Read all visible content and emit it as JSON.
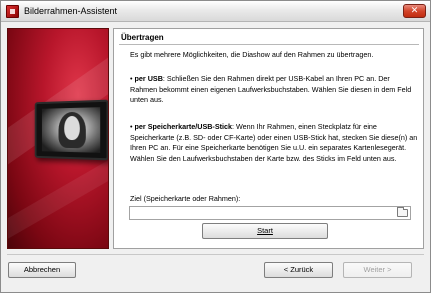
{
  "window": {
    "title": "Bilderrahmen-Assistent",
    "close_glyph": "✕"
  },
  "banner": {
    "image": "digital-photo-frame-icon"
  },
  "panel": {
    "heading": "Übertragen",
    "intro": "Es gibt mehrere Möglichkeiten, die Diashow auf den Rahmen zu übertragen.",
    "usb_bullet": "•",
    "usb_title": "per USB",
    "usb_text": ": Schließen Sie den Rahmen direkt per USB-Kabel an Ihren PC an. Der Rahmen bekommt einen eigenen Laufwerksbuchstaben. Wählen Sie diesen in dem Feld unten aus.",
    "card_bullet": "•",
    "card_title": "per Speicherkarte/USB-Stick",
    "card_text": ": Wenn Ihr Rahmen, einen Steckplatz für eine Speicherkarte (z.B. SD- oder CF-Karte) oder einen USB-Stick hat, stecken Sie diese(n)  an Ihren PC an. Für eine Speicherkarte benötigen Sie u.U. ein separates Kartenlesegerät. Wählen Sie den Laufwerksbuchstaben der Karte bzw. des Sticks im Feld unten aus.",
    "target_label": "Ziel (Speicherkarte oder Rahmen):",
    "target_value": "",
    "start_label": "Start"
  },
  "footer": {
    "cancel_label": "Abbrechen",
    "back_label": "< Zurück",
    "next_label": "Weiter >"
  },
  "colors": {
    "banner_red": "#b8162b",
    "close_red": "#d2442a"
  }
}
